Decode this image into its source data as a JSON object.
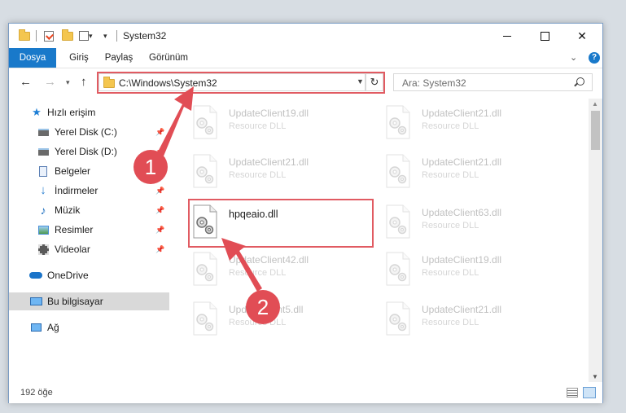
{
  "window": {
    "title": "System32",
    "controls": {
      "minimize": "minimize-icon",
      "maximize": "maximize-icon",
      "close": "✕"
    }
  },
  "ribbon": {
    "tabs": [
      "Dosya",
      "Giriş",
      "Paylaş",
      "Görünüm"
    ],
    "help": "?"
  },
  "nav": {
    "back": "←",
    "forward": "→",
    "recent": "▾",
    "up": "↑",
    "address": "C:\\Windows\\System32",
    "refresh": "↻",
    "search_placeholder": "Ara: System32"
  },
  "sidebar": {
    "items": [
      {
        "label": "Hızlı erişim",
        "icon": "star-icon",
        "pinned": false
      },
      {
        "label": "Yerel Disk (C:)",
        "icon": "drive-icon",
        "pinned": true
      },
      {
        "label": "Yerel Disk (D:)",
        "icon": "drive-icon",
        "pinned": true
      },
      {
        "label": "Belgeler",
        "icon": "document-icon",
        "pinned": false
      },
      {
        "label": "İndirmeler",
        "icon": "download-icon",
        "pinned": true
      },
      {
        "label": "Müzik",
        "icon": "music-icon",
        "pinned": true
      },
      {
        "label": "Resimler",
        "icon": "pictures-icon",
        "pinned": true
      },
      {
        "label": "Videolar",
        "icon": "videos-icon",
        "pinned": true
      },
      {
        "label": "OneDrive",
        "icon": "cloud-icon",
        "pinned": false
      },
      {
        "label": "Bu bilgisayar",
        "icon": "computer-icon",
        "pinned": false,
        "selected": true
      },
      {
        "label": "Ağ",
        "icon": "network-icon",
        "pinned": false
      }
    ]
  },
  "files": [
    {
      "name": "UpdateClient19.dll",
      "type": "Resource DLL"
    },
    {
      "name": "UpdateClient21.dll",
      "type": "Resource DLL"
    },
    {
      "name": "UpdateClient21.dll",
      "type": "Resource DLL"
    },
    {
      "name": "UpdateClient21.dll",
      "type": "Resource DLL"
    },
    {
      "name": "hpqeaio.dll",
      "type": ""
    },
    {
      "name": "UpdateClient63.dll",
      "type": "Resource DLL"
    },
    {
      "name": "UpdateClient42.dll",
      "type": "Resource DLL"
    },
    {
      "name": "UpdateClient19.dll",
      "type": "Resource DLL"
    },
    {
      "name": "UpdateClient5.dll",
      "type": "Resource DLL"
    },
    {
      "name": "UpdateClient21.dll",
      "type": "Resource DLL"
    }
  ],
  "status": {
    "count": "192 öğe"
  },
  "annotations": {
    "badge1": "1",
    "badge2": "2",
    "color": "#e14d55"
  }
}
